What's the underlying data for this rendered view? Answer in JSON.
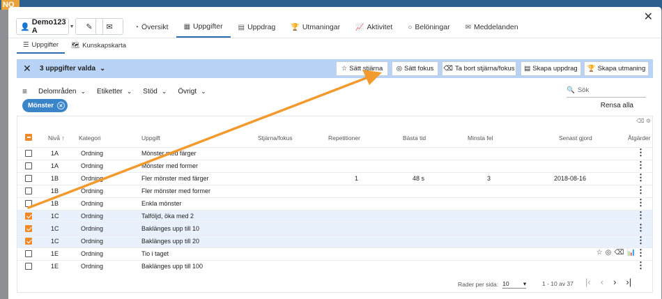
{
  "brand": {
    "logo_text": "NO"
  },
  "header": {
    "user": "Demo123 A",
    "edit_icon": "pencil-icon",
    "mail_icon": "envelope-icon",
    "tabs": [
      {
        "label": "Översikt",
        "icon": "gauge-icon"
      },
      {
        "label": "Uppgifter",
        "icon": "grid-icon"
      },
      {
        "label": "Uppdrag",
        "icon": "document-icon"
      },
      {
        "label": "Utmaningar",
        "icon": "trophy-icon"
      },
      {
        "label": "Aktivitet",
        "icon": "chart-icon"
      },
      {
        "label": "Belöningar",
        "icon": "circle-icon"
      },
      {
        "label": "Meddelanden",
        "icon": "envelope-icon"
      }
    ],
    "active_tab": "Uppgifter"
  },
  "subtabs": [
    {
      "label": "Uppgifter",
      "icon": "list-icon"
    },
    {
      "label": "Kunskapskarta",
      "icon": "map-icon"
    }
  ],
  "selection_bar": {
    "count_label": "3 uppgifter valda",
    "actions": [
      "Sätt stjärna",
      "Sätt fokus",
      "Ta bort stjärna/fokus",
      "Skapa uppdrag",
      "Skapa utmaning"
    ]
  },
  "filters": {
    "dropdowns": [
      "Delområden",
      "Etiketter",
      "Stöd",
      "Övrigt"
    ],
    "search_placeholder": "Sök",
    "chip": "Mönster",
    "clear_all": "Rensa alla"
  },
  "table": {
    "columns": [
      "Nivå",
      "Kategori",
      "Uppgift",
      "Stjärna/fokus",
      "Repetitioner",
      "Bästa tid",
      "Minsta fel",
      "Senast gjord",
      "Åtgärder"
    ],
    "rows": [
      {
        "level": "1A",
        "category": "Ordning",
        "task": "Mönster med färger",
        "reps": "",
        "best": "",
        "min_err": "",
        "last": "",
        "selected": false
      },
      {
        "level": "1A",
        "category": "Ordning",
        "task": "Mönster med former",
        "reps": "",
        "best": "",
        "min_err": "",
        "last": "",
        "selected": false
      },
      {
        "level": "1B",
        "category": "Ordning",
        "task": "Fler mönster med färger",
        "reps": "1",
        "best": "48 s",
        "min_err": "3",
        "last": "2018-08-16",
        "selected": false
      },
      {
        "level": "1B",
        "category": "Ordning",
        "task": "Fler mönster med former",
        "reps": "",
        "best": "",
        "min_err": "",
        "last": "",
        "selected": false
      },
      {
        "level": "1B",
        "category": "Ordning",
        "task": "Enkla mönster",
        "reps": "",
        "best": "",
        "min_err": "",
        "last": "",
        "selected": false
      },
      {
        "level": "1C",
        "category": "Ordning",
        "task": "Talföljd, öka med 2",
        "reps": "",
        "best": "",
        "min_err": "",
        "last": "",
        "selected": true
      },
      {
        "level": "1C",
        "category": "Ordning",
        "task": "Baklänges upp till 10",
        "reps": "",
        "best": "",
        "min_err": "",
        "last": "",
        "selected": true
      },
      {
        "level": "1C",
        "category": "Ordning",
        "task": "Baklänges upp till 20",
        "reps": "",
        "best": "",
        "min_err": "",
        "last": "",
        "selected": true
      },
      {
        "level": "1E",
        "category": "Ordning",
        "task": "Tio i taget",
        "reps": "",
        "best": "",
        "min_err": "",
        "last": "",
        "selected": false
      },
      {
        "level": "1E",
        "category": "Ordning",
        "task": "Baklänges upp till 100",
        "reps": "",
        "best": "",
        "min_err": "",
        "last": "",
        "selected": false
      }
    ]
  },
  "pagination": {
    "rows_per_page_label": "Rader per sida:",
    "rows_per_page": "10",
    "range": "1 - 10 av 37"
  },
  "colors": {
    "accent": "#2b6cb0",
    "selection_bar": "#b8d3f5",
    "checkbox": "#ee8a2a",
    "annotation_arrow": "#f39a2e"
  }
}
